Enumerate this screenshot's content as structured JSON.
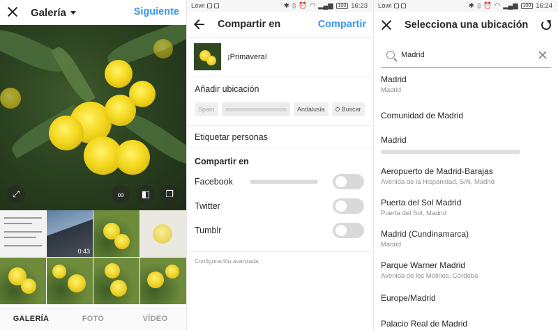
{
  "gallery": {
    "title": "Galería",
    "next_label": "Siguiente",
    "video_duration": "0:43",
    "tabs": [
      "GALERÍA",
      "FOTO",
      "VÍDEO"
    ]
  },
  "share": {
    "status": {
      "carrier": "Lowi",
      "battery": "100",
      "time": "16:23"
    },
    "title": "Compartir en",
    "share_label": "Compartir",
    "caption": "¡Primavera!",
    "add_location": "Añadir ubicación",
    "chips": [
      "Spain",
      "",
      "Andalusia",
      "Buscar"
    ],
    "tag_people": "Etiquetar personas",
    "share_section": "Compartir en",
    "networks": [
      "Facebook",
      "Twitter",
      "Tumblr"
    ],
    "advanced": "Configuración avanzada"
  },
  "location": {
    "status": {
      "carrier": "Lowi",
      "battery": "100",
      "time": "16:24"
    },
    "title": "Selecciona una ubicación",
    "search_value": "Madrid",
    "results": [
      {
        "name": "Madrid",
        "sub": "Madrid"
      },
      {
        "name": "Comunidad de Madrid",
        "sub": ""
      },
      {
        "name": "Madrid",
        "sub": ""
      },
      {
        "name": "Aeropuerto de Madrid-Barajas",
        "sub": "Avenida de la Hispanidad, S/N, Madrid"
      },
      {
        "name": "Puerta del Sol Madrid",
        "sub": "Puerta del Sol, Madrid"
      },
      {
        "name": "Madrid (Cundinamarca)",
        "sub": "Madrid"
      },
      {
        "name": "Parque Warner Madrid",
        "sub": "Avenida de los Molinos, Córdoba"
      },
      {
        "name": "Europe/Madrid",
        "sub": ""
      },
      {
        "name": "Palacio Real de Madrid",
        "sub": ""
      }
    ]
  },
  "colors": {
    "accent": "#3897f0",
    "text": "#262626",
    "muted": "#8e8e8e"
  }
}
